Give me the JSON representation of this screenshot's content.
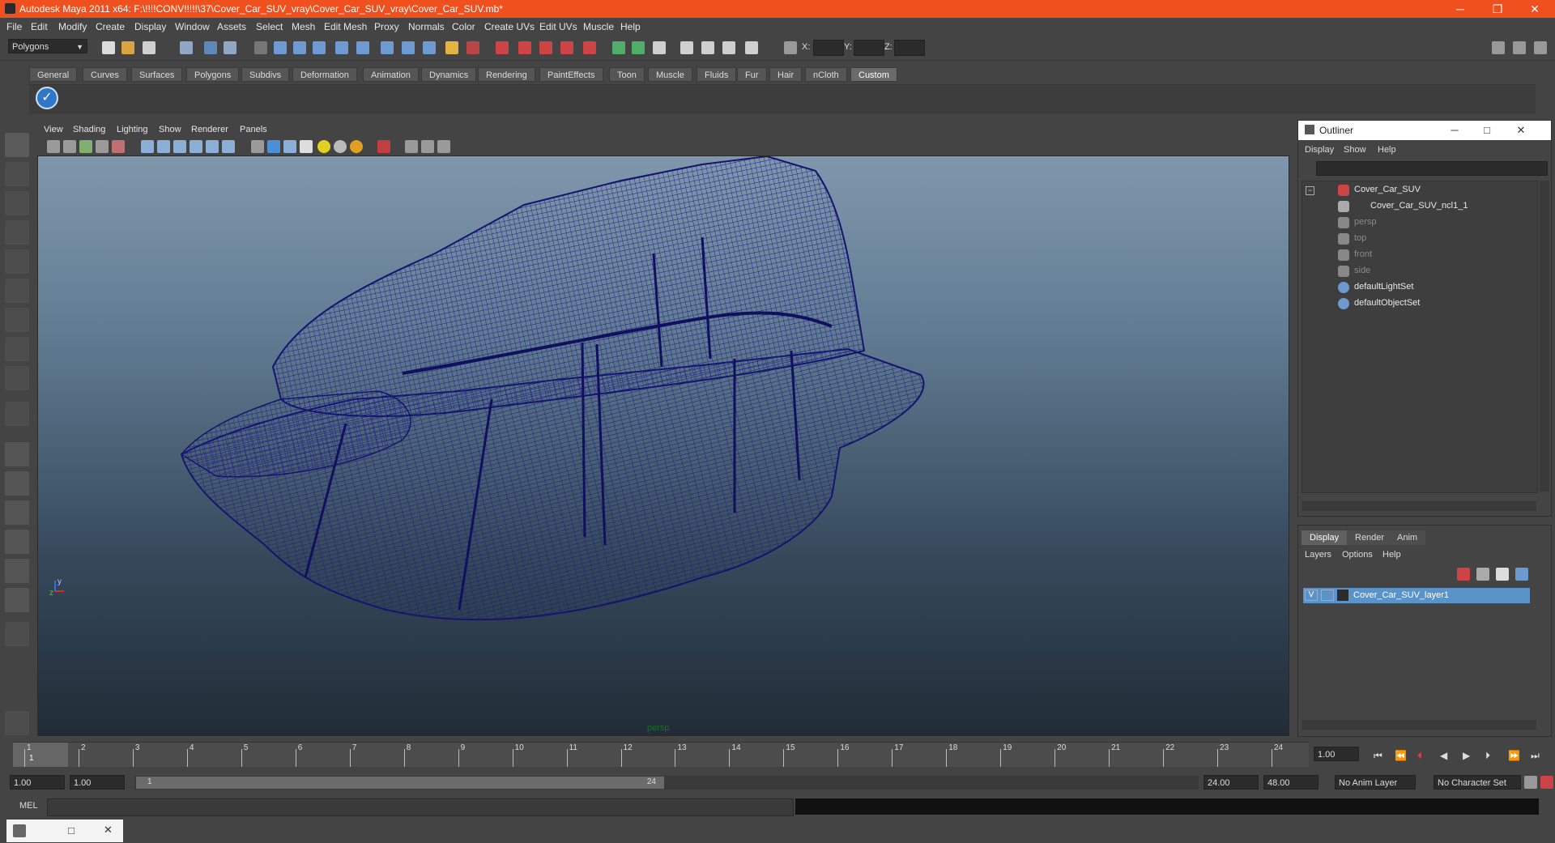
{
  "window": {
    "title": "Autodesk Maya 2011 x64: F:\\!!!!CONV!!!!!\\37\\Cover_Car_SUV_vray\\Cover_Car_SUV_vray\\Cover_Car_SUV.mb*",
    "minimize": "─",
    "restore": "❐",
    "close": "✕"
  },
  "menubar": [
    "File",
    "Edit",
    "Modify",
    "Create",
    "Display",
    "Window",
    "Assets",
    "Select",
    "Mesh",
    "Edit Mesh",
    "Proxy",
    "Normals",
    "Color",
    "Create UVs",
    "Edit UVs",
    "Muscle",
    "Help"
  ],
  "statusline": {
    "mode": "Polygons",
    "x_label": "X:",
    "y_label": "Y:",
    "z_label": "Z:"
  },
  "shelf": {
    "tabs": [
      "General",
      "Curves",
      "Surfaces",
      "Polygons",
      "Subdivs",
      "Deformation",
      "Animation",
      "Dynamics",
      "Rendering",
      "PaintEffects",
      "Toon",
      "Muscle",
      "Fluids",
      "Fur",
      "Hair",
      "nCloth",
      "Custom"
    ],
    "active_tab": "Custom"
  },
  "viewport": {
    "menu": [
      "View",
      "Shading",
      "Lighting",
      "Show",
      "Renderer",
      "Panels"
    ],
    "camera_label": "persp",
    "axis_y": "y",
    "axis_z": "z",
    "wire_color": "#1a1a7a",
    "bg_top": "#7f97ac",
    "bg_bottom": "#212c37"
  },
  "outliner": {
    "title": "Outliner",
    "menu": [
      "Display",
      "Show",
      "Help"
    ],
    "items": [
      {
        "label": "Cover_Car_SUV",
        "icon": "transform-icon",
        "dim": false
      },
      {
        "label": "Cover_Car_SUV_ncl1_1",
        "icon": "mesh-icon",
        "dim": false
      },
      {
        "label": "persp",
        "icon": "camera-icon",
        "dim": true
      },
      {
        "label": "top",
        "icon": "camera-icon",
        "dim": true
      },
      {
        "label": "front",
        "icon": "camera-icon",
        "dim": true
      },
      {
        "label": "side",
        "icon": "camera-icon",
        "dim": true
      },
      {
        "label": "defaultLightSet",
        "icon": "set-icon",
        "dim": false
      },
      {
        "label": "defaultObjectSet",
        "icon": "set-icon",
        "dim": false
      }
    ]
  },
  "layers": {
    "tabs": [
      "Display",
      "Render",
      "Anim"
    ],
    "active_tab": "Display",
    "menu": [
      "Layers",
      "Options",
      "Help"
    ],
    "rows": [
      {
        "visible": "V",
        "name": "Cover_Car_SUV_layer1"
      }
    ]
  },
  "timeline": {
    "ticks": [
      "1",
      "2",
      "3",
      "4",
      "5",
      "6",
      "7",
      "8",
      "9",
      "10",
      "11",
      "12",
      "13",
      "14",
      "15",
      "16",
      "17",
      "18",
      "19",
      "20",
      "21",
      "22",
      "23",
      "24"
    ],
    "current_frame_marker": "1",
    "current_time": "1.00"
  },
  "range": {
    "start": "1.00",
    "start2": "1.00",
    "slider_start": "1",
    "slider_end": "24",
    "end": "24.00",
    "end2": "48.00",
    "anim_layer": "No Anim Layer",
    "character_set": "No Character Set"
  },
  "cmdline": {
    "label": "MEL"
  }
}
